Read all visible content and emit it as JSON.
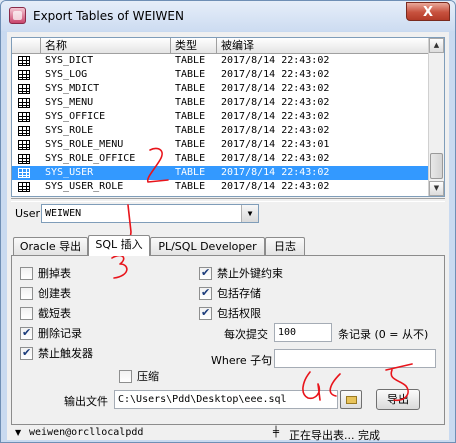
{
  "window": {
    "title": "Export Tables of WEIWEN",
    "close_label": "X"
  },
  "table_list": {
    "columns": [
      "名称",
      "类型",
      "被编译"
    ],
    "rows": [
      {
        "name": "SYS_DICT",
        "type": "TABLE",
        "compiled": "2017/8/14 22:43:02",
        "selected": false
      },
      {
        "name": "SYS_LOG",
        "type": "TABLE",
        "compiled": "2017/8/14 22:43:02",
        "selected": false
      },
      {
        "name": "SYS_MDICT",
        "type": "TABLE",
        "compiled": "2017/8/14 22:43:02",
        "selected": false
      },
      {
        "name": "SYS_MENU",
        "type": "TABLE",
        "compiled": "2017/8/14 22:43:02",
        "selected": false
      },
      {
        "name": "SYS_OFFICE",
        "type": "TABLE",
        "compiled": "2017/8/14 22:43:02",
        "selected": false
      },
      {
        "name": "SYS_ROLE",
        "type": "TABLE",
        "compiled": "2017/8/14 22:43:02",
        "selected": false
      },
      {
        "name": "SYS_ROLE_MENU",
        "type": "TABLE",
        "compiled": "2017/8/14 22:43:01",
        "selected": false
      },
      {
        "name": "SYS_ROLE_OFFICE",
        "type": "TABLE",
        "compiled": "2017/8/14 22:43:02",
        "selected": false
      },
      {
        "name": "SYS_USER",
        "type": "TABLE",
        "compiled": "2017/8/14 22:43:02",
        "selected": true
      },
      {
        "name": "SYS_USER_ROLE",
        "type": "TABLE",
        "compiled": "2017/8/14 22:43:02",
        "selected": false
      }
    ]
  },
  "user": {
    "label": "User",
    "value": "WEIWEN"
  },
  "tabs": [
    {
      "label": "Oracle 导出",
      "active": false
    },
    {
      "label": "SQL 插入",
      "active": true
    },
    {
      "label": "PL/SQL Developer",
      "active": false
    },
    {
      "label": "日志",
      "active": false
    }
  ],
  "options": {
    "drop_tables": {
      "label": "删掉表",
      "checked": false
    },
    "create_tables": {
      "label": "创建表",
      "checked": false
    },
    "truncate_tables": {
      "label": "截短表",
      "checked": false
    },
    "delete_records": {
      "label": "删除记录",
      "checked": true
    },
    "disable_triggers": {
      "label": "禁止触发器",
      "checked": true
    },
    "disable_fk": {
      "label": "禁止外键约束",
      "checked": true
    },
    "include_storage": {
      "label": "包括存储",
      "checked": true
    },
    "include_privileges": {
      "label": "包括权限",
      "checked": true
    },
    "compress": {
      "label": "压缩",
      "checked": false
    }
  },
  "commit": {
    "label_prefix": "每次提交",
    "value": "100",
    "label_suffix": "条记录 (0 = 从不)"
  },
  "where": {
    "label": "Where 子句",
    "value": ""
  },
  "output": {
    "label": "输出文件",
    "path": "C:\\Users\\Pdd\\Desktop\\eee.sql"
  },
  "export_button": "导出",
  "status": {
    "connection": "weiwen@orcllocalpdd",
    "message": "正在导出表... 完成"
  },
  "annotations": [
    "1",
    "2",
    "3",
    "4",
    "5"
  ],
  "colors": {
    "selection": "#3399ff",
    "annotation": "#e8141b"
  }
}
